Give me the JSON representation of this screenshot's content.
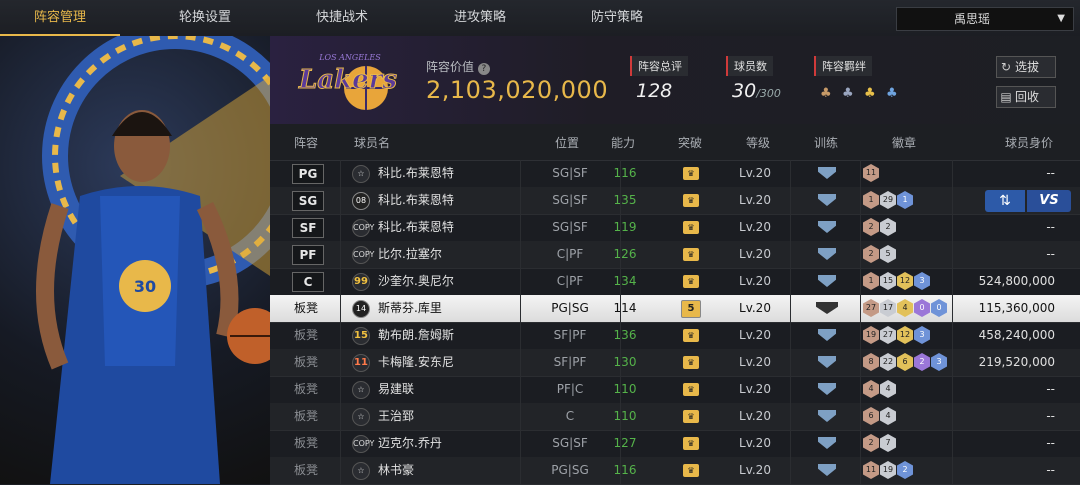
{
  "tabs": [
    {
      "label": "阵容管理",
      "active": true
    },
    {
      "label": "轮换设置",
      "active": false
    },
    {
      "label": "快捷战术",
      "active": false
    },
    {
      "label": "进攻策略",
      "active": false
    },
    {
      "label": "防守策略",
      "active": false
    }
  ],
  "user": {
    "name": "禹思瑶"
  },
  "header": {
    "value_label": "阵容价值",
    "value": "2,103,020,000",
    "rating_label": "阵容总评",
    "rating": "128",
    "players_label": "球员数",
    "players": "30",
    "players_max": "/300",
    "bond_label": "阵容羁绊",
    "btn_select": "选拔",
    "btn_recycle": "回收",
    "logo_top": "LOS ANGELES",
    "logo_main": "Lakers"
  },
  "columns": {
    "lineup": "阵容",
    "player": "球员名",
    "position": "位置",
    "ability": "能力",
    "breakthrough": "突破",
    "level": "等级",
    "training": "训练",
    "badges": "徽章",
    "worth": "球员身价"
  },
  "vs": {
    "label": "VS"
  },
  "rows": [
    {
      "slot": "PG",
      "chip": "☆",
      "chipType": "",
      "name": "科比.布莱恩特",
      "pos": "SG|SF",
      "ability": "116",
      "brk": "♛",
      "level": "Lv.20",
      "badges": [
        [
          "br",
          "11"
        ]
      ],
      "worth": "--"
    },
    {
      "slot": "SG",
      "chip": "08",
      "chipType": "dark",
      "name": "科比.布莱恩特",
      "pos": "SG|SF",
      "ability": "135",
      "brk": "♛",
      "level": "Lv.20",
      "badges": [
        [
          "br",
          "1"
        ],
        [
          "sv",
          "29"
        ],
        [
          "bl",
          "1"
        ]
      ],
      "worth": ""
    },
    {
      "slot": "SF",
      "chip": "COPY",
      "chipType": "",
      "name": "科比.布莱恩特",
      "pos": "SG|SF",
      "ability": "119",
      "brk": "♛",
      "level": "Lv.20",
      "badges": [
        [
          "br",
          "2"
        ],
        [
          "sv",
          "2"
        ]
      ],
      "worth": "--"
    },
    {
      "slot": "PF",
      "chip": "COPY",
      "chipType": "",
      "name": "比尔.拉塞尔",
      "pos": "C|PF",
      "ability": "126",
      "brk": "♛",
      "level": "Lv.20",
      "badges": [
        [
          "br",
          "2"
        ],
        [
          "sv",
          "5"
        ]
      ],
      "worth": "--"
    },
    {
      "slot": "C",
      "chip": "99",
      "chipType": "gold",
      "name": "沙奎尔.奥尼尔",
      "pos": "C|PF",
      "ability": "134",
      "brk": "♛",
      "level": "Lv.20",
      "badges": [
        [
          "br",
          "1"
        ],
        [
          "sv",
          "15"
        ],
        [
          "gd",
          "12"
        ],
        [
          "bl",
          "3"
        ]
      ],
      "worth": "524,800,000"
    },
    {
      "slot": "板凳",
      "chip": "14",
      "chipType": "dark",
      "name": "斯蒂芬.库里",
      "pos": "PG|SG",
      "ability": "114",
      "brk": "5",
      "level": "Lv.20",
      "badges": [
        [
          "br",
          "27"
        ],
        [
          "sv",
          "17"
        ],
        [
          "gd",
          "4"
        ],
        [
          "pu",
          "0"
        ],
        [
          "bl",
          "0"
        ]
      ],
      "worth": "115,360,000"
    },
    {
      "slot": "板凳",
      "chip": "15",
      "chipType": "gold",
      "name": "勒布朗.詹姆斯",
      "pos": "SF|PF",
      "ability": "136",
      "brk": "♛",
      "level": "Lv.20",
      "badges": [
        [
          "br",
          "19"
        ],
        [
          "sv",
          "27"
        ],
        [
          "gd",
          "12"
        ],
        [
          "bl",
          "3"
        ]
      ],
      "worth": "458,240,000"
    },
    {
      "slot": "板凳",
      "chip": "11",
      "chipType": "red",
      "name": "卡梅隆.安东尼",
      "pos": "SF|PF",
      "ability": "130",
      "brk": "♛",
      "level": "Lv.20",
      "badges": [
        [
          "br",
          "8"
        ],
        [
          "sv",
          "22"
        ],
        [
          "gd",
          "6"
        ],
        [
          "pu",
          "2"
        ],
        [
          "bl",
          "3"
        ]
      ],
      "worth": "219,520,000"
    },
    {
      "slot": "板凳",
      "chip": "☆",
      "chipType": "",
      "name": "易建联",
      "pos": "PF|C",
      "ability": "110",
      "brk": "♛",
      "level": "Lv.20",
      "badges": [
        [
          "br",
          "4"
        ],
        [
          "sv",
          "4"
        ]
      ],
      "worth": "--"
    },
    {
      "slot": "板凳",
      "chip": "☆",
      "chipType": "",
      "name": "王治郅",
      "pos": "C",
      "ability": "110",
      "brk": "♛",
      "level": "Lv.20",
      "badges": [
        [
          "br",
          "6"
        ],
        [
          "sv",
          "4"
        ]
      ],
      "worth": "--"
    },
    {
      "slot": "板凳",
      "chip": "COPY",
      "chipType": "",
      "name": "迈克尔.乔丹",
      "pos": "SG|SF",
      "ability": "127",
      "brk": "♛",
      "level": "Lv.20",
      "badges": [
        [
          "br",
          "2"
        ],
        [
          "sv",
          "7"
        ]
      ],
      "worth": "--"
    },
    {
      "slot": "板凳",
      "chip": "☆",
      "chipType": "",
      "name": "林书豪",
      "pos": "PG|SG",
      "ability": "116",
      "brk": "♛",
      "level": "Lv.20",
      "badges": [
        [
          "br",
          "11"
        ],
        [
          "sv",
          "19"
        ],
        [
          "bl",
          "2"
        ]
      ],
      "worth": "--"
    }
  ]
}
